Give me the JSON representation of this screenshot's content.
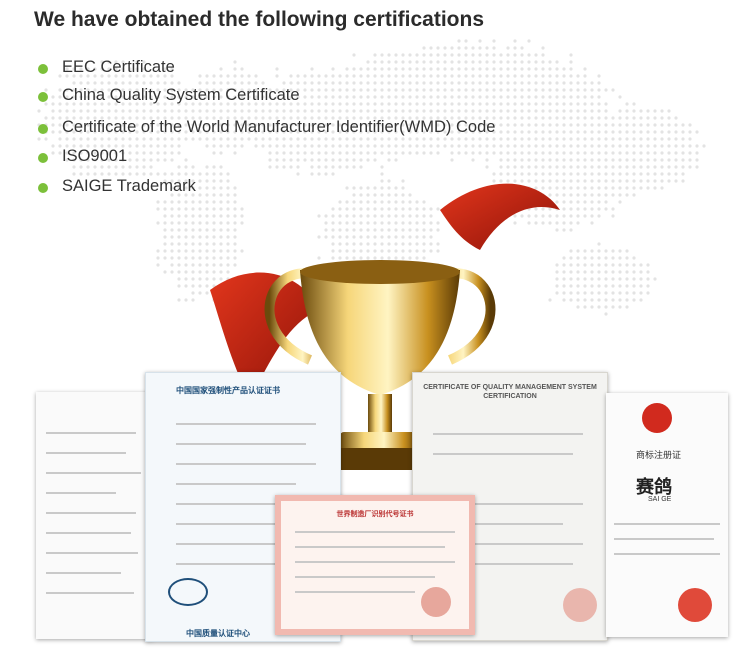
{
  "heading": "We have obtained the following certifications",
  "certifications": [
    "EEC Certificate",
    "China Quality System Certificate",
    "Certificate of the World Manufacturer Identifier(WMD) Code",
    "ISO9001",
    "SAIGE Trademark"
  ],
  "documents": {
    "ccc_title": "中国国家强制性产品认证证书",
    "ccc_footer": "中国质量认证中心",
    "qms_title": "CERTIFICATE OF QUALITY MANAGEMENT SYSTEM CERTIFICATION",
    "trademark_title": "商标注册证",
    "trademark_name": "赛鸽",
    "trademark_sub": "SAI GE",
    "wmi_title": "世界制造厂识别代号证书"
  },
  "colors": {
    "bullet": "#7cc03a",
    "heading": "#2b2b2b",
    "text": "#333333"
  }
}
